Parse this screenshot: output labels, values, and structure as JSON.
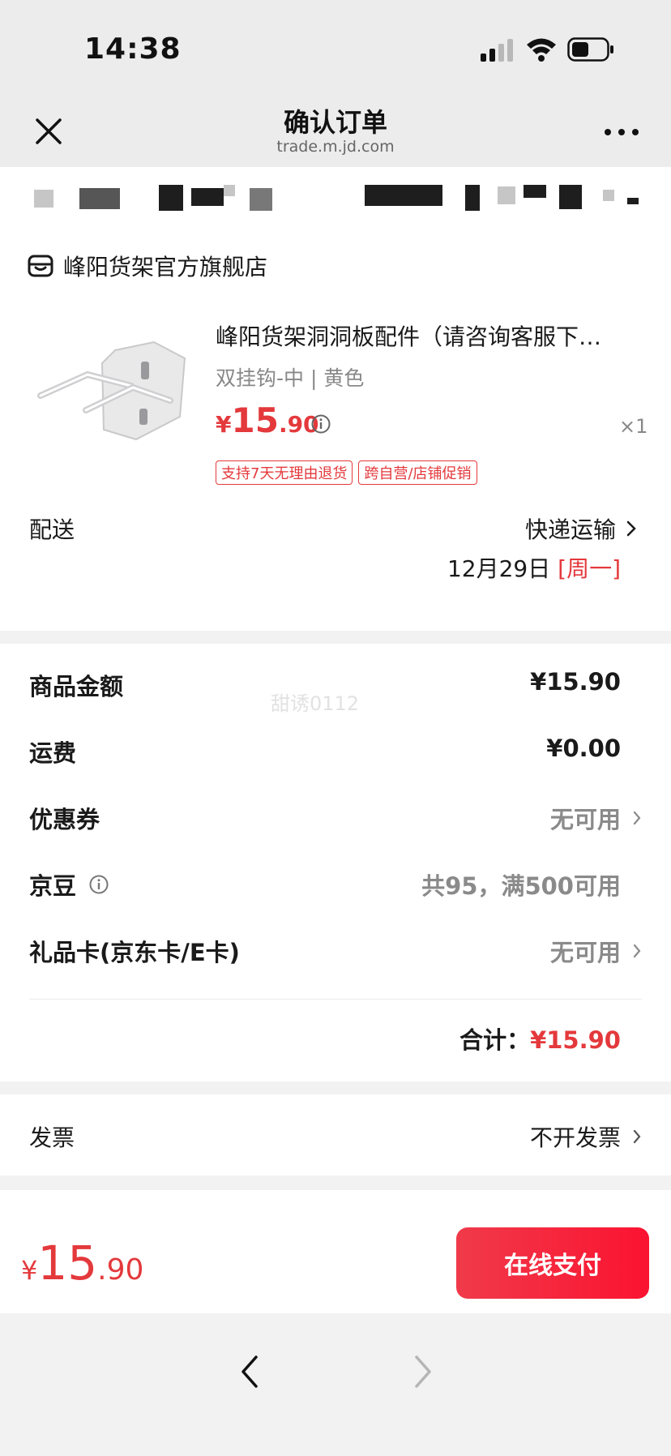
{
  "status_bar": {
    "time": "14:38",
    "icons": [
      "signal-icon",
      "wifi-icon",
      "battery-icon"
    ]
  },
  "nav": {
    "title": "确认订单",
    "url": "trade.m.jd.com",
    "close_icon": "close-icon",
    "more_icon": "more-icon"
  },
  "store": {
    "name": "峰阳货架官方旗舰店",
    "icon": "store-icon"
  },
  "product": {
    "title": "峰阳货架洞洞板配件（请咨询客服下…",
    "spec": "双挂钩-中 | 黄色",
    "price_symbol": "¥",
    "price_int": "15",
    "price_dec": ".90",
    "quantity": "×1",
    "tags": [
      "支持7天无理由退货",
      "跨自营/店铺促销"
    ]
  },
  "shipping": {
    "label": "配送",
    "method": "快递运输",
    "date": "12月29日",
    "day": "[周一]"
  },
  "summary": {
    "rows": [
      {
        "label": "商品金额",
        "value": "¥15.90"
      },
      {
        "label": "运费",
        "value": "¥0.00"
      },
      {
        "label": "优惠券",
        "value": "无可用"
      },
      {
        "label": "京豆",
        "value": "共95，满500可用"
      },
      {
        "label": "礼品卡(京东卡/E卡)",
        "value": "无可用"
      }
    ],
    "total_label": "合计：",
    "total_value": "¥15.90",
    "watermark": "甜诱0112"
  },
  "invoice": {
    "label": "发票",
    "value": "不开发票"
  },
  "footer": {
    "price_symbol": "¥",
    "price_int": "15",
    "price_dec": ".90",
    "pay_label": "在线支付"
  },
  "colors": {
    "accent": "#e4393c",
    "pay_button": "#f5223a",
    "background": "#f2f2f2"
  }
}
